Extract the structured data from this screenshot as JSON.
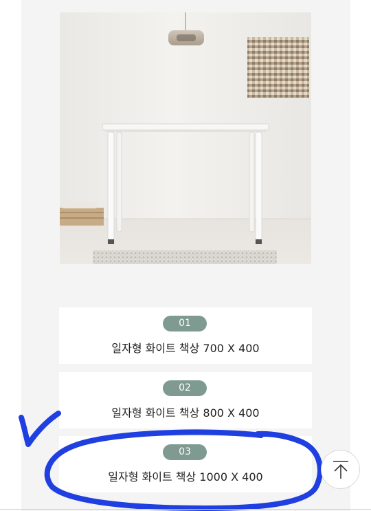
{
  "product_image": {
    "alt": "white straight desk in a room"
  },
  "options": [
    {
      "number": "01",
      "label": "일자형 화이트 책상  700 X 400"
    },
    {
      "number": "02",
      "label": "일자형 화이트 책상  800 X 400"
    },
    {
      "number": "03",
      "label": "일자형 화이트 책상  1000 X 400"
    }
  ],
  "top_button": {
    "icon": "arrow-up-to-top-icon"
  },
  "colors": {
    "badge": "#7e9a91",
    "annotation": "#1f3fe0"
  }
}
